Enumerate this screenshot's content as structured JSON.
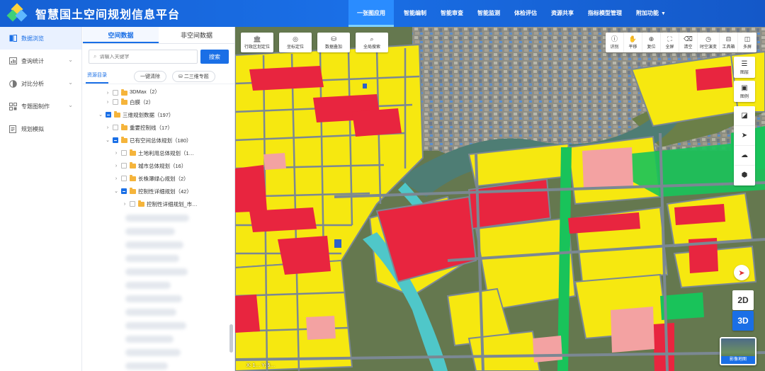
{
  "header": {
    "title": "智慧国土空间规划信息平台",
    "nav": [
      {
        "label": "一张图应用",
        "active": true
      },
      {
        "label": "智能编制"
      },
      {
        "label": "智能审查"
      },
      {
        "label": "智能监测"
      },
      {
        "label": "体检评估"
      },
      {
        "label": "资源共享"
      },
      {
        "label": "指标模型管理"
      },
      {
        "label": "附加功能",
        "dropdown": true
      }
    ]
  },
  "leftmenu": {
    "items": [
      {
        "label": "数据浏览",
        "icon": "book-icon",
        "active": true
      },
      {
        "label": "查询统计",
        "icon": "chart-icon",
        "chevron": true
      },
      {
        "label": "对比分析",
        "icon": "compare-icon",
        "chevron": true
      },
      {
        "label": "专题图制作",
        "icon": "grid-icon",
        "chevron": true
      },
      {
        "label": "规划模拟",
        "icon": "doc-icon"
      }
    ]
  },
  "panel": {
    "tabs": [
      "空间数据",
      "非空间数据"
    ],
    "search_placeholder": "请输入关键字",
    "search_button": "搜索",
    "source_label": "资源目录",
    "clear_button": "一键清除",
    "mode_button": "二三维专题",
    "tree": [
      {
        "label": "3DMax（2）",
        "level": 2,
        "expanded": false
      },
      {
        "label": "白膜（2）",
        "level": 2,
        "expanded": false
      },
      {
        "label": "三维规划数据（197）",
        "level": 1,
        "expanded": true,
        "checked": "partial"
      },
      {
        "label": "重要控制线（17）",
        "level": 2,
        "expanded": false
      },
      {
        "label": "已有空间总体规划（180）",
        "level": 2,
        "expanded": true,
        "checked": "partial"
      },
      {
        "label": "土地利用总体规划（1…",
        "level": 3,
        "expanded": false
      },
      {
        "label": "城市总体规划（16）",
        "level": 3,
        "expanded": false
      },
      {
        "label": "长株潭绿心规划（2）",
        "level": 3,
        "expanded": false
      },
      {
        "label": "控制性详细规划（42）",
        "level": 3,
        "expanded": true,
        "checked": "partial"
      },
      {
        "label": "控制性详细规划_市…",
        "level": 4,
        "expanded": false
      }
    ]
  },
  "map": {
    "left_tools": [
      {
        "label": "行政区划定位",
        "icon": "building-icon"
      },
      {
        "label": "坐标定位",
        "icon": "target-icon"
      },
      {
        "label": "数据叠加",
        "icon": "database-icon"
      },
      {
        "label": "全局搜索",
        "icon": "search-icon"
      }
    ],
    "right_tools": [
      {
        "label": "识别",
        "icon": "info-icon"
      },
      {
        "label": "平移",
        "icon": "hand-icon"
      },
      {
        "label": "复位",
        "icon": "globe-icon"
      },
      {
        "label": "全屏",
        "icon": "fullscreen-icon"
      },
      {
        "label": "清空",
        "icon": "eraser-icon"
      },
      {
        "label": "时空演变",
        "icon": "clock-icon"
      },
      {
        "label": "工具箱",
        "icon": "toolbox-icon"
      },
      {
        "label": "多屏",
        "icon": "split-icon"
      }
    ],
    "side_buttons": [
      {
        "label": "图层",
        "icon": "layers-icon"
      },
      {
        "label": "图例",
        "icon": "legend-icon"
      }
    ],
    "side_tools": [
      {
        "icon": "measure-icon"
      },
      {
        "icon": "send-icon"
      },
      {
        "icon": "cloud-icon"
      },
      {
        "icon": "cube-icon"
      }
    ],
    "btn_2d": "2D",
    "btn_3d": "3D",
    "basemap_label": "影像地图",
    "coords": "X: 1… Y: 5…"
  },
  "colors": {
    "brand": "#1a6fe6",
    "yellow_land": "#f7e90e",
    "red_land": "#e8253f",
    "green_land": "#19c35a",
    "river": "#4fc7c9",
    "road": "#7b8893"
  }
}
